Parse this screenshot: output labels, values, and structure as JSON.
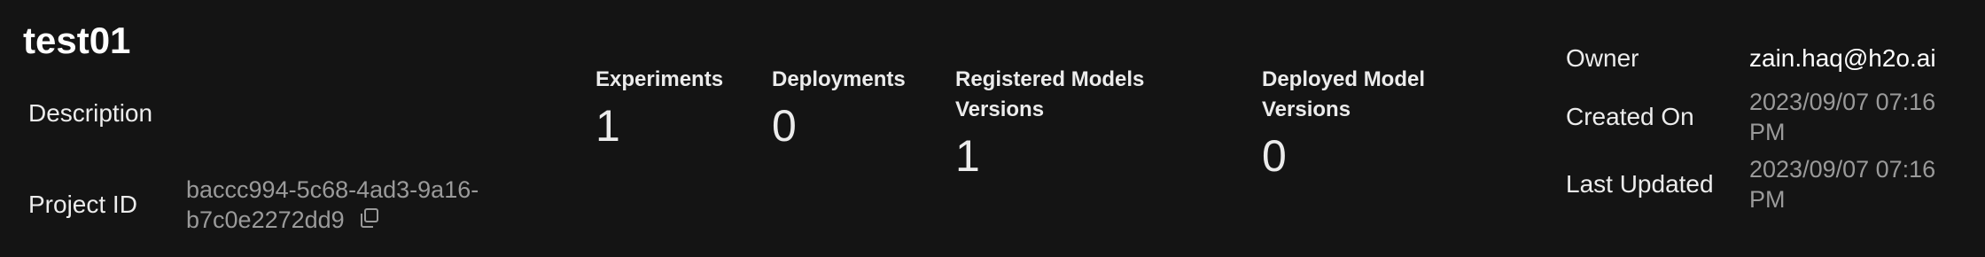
{
  "project": {
    "name": "test01",
    "description_label": "Description",
    "project_id_label": "Project ID",
    "project_id_line1": "baccc994-5c68-4ad3-9a16-",
    "project_id_line2": "b7c0e2272dd9"
  },
  "stats": [
    {
      "label": "Experiments",
      "value": "1"
    },
    {
      "label": "Deployments",
      "value": "0"
    },
    {
      "label": "Registered Models\nVersions",
      "value": "1"
    },
    {
      "label": "Deployed Model\nVersions",
      "value": "0"
    }
  ],
  "meta": {
    "owner_label": "Owner",
    "owner_value": "zain.haq@h2o.ai",
    "created_label": "Created On",
    "created_value": "2023/09/07 07:16\nPM",
    "updated_label": "Last Updated",
    "updated_value": "2023/09/07 07:16\nPM"
  },
  "icons": {
    "copy": "copy-icon"
  },
  "colors": {
    "background": "#141414",
    "muted_text": "#9a9a9a",
    "text": "#ececec"
  }
}
